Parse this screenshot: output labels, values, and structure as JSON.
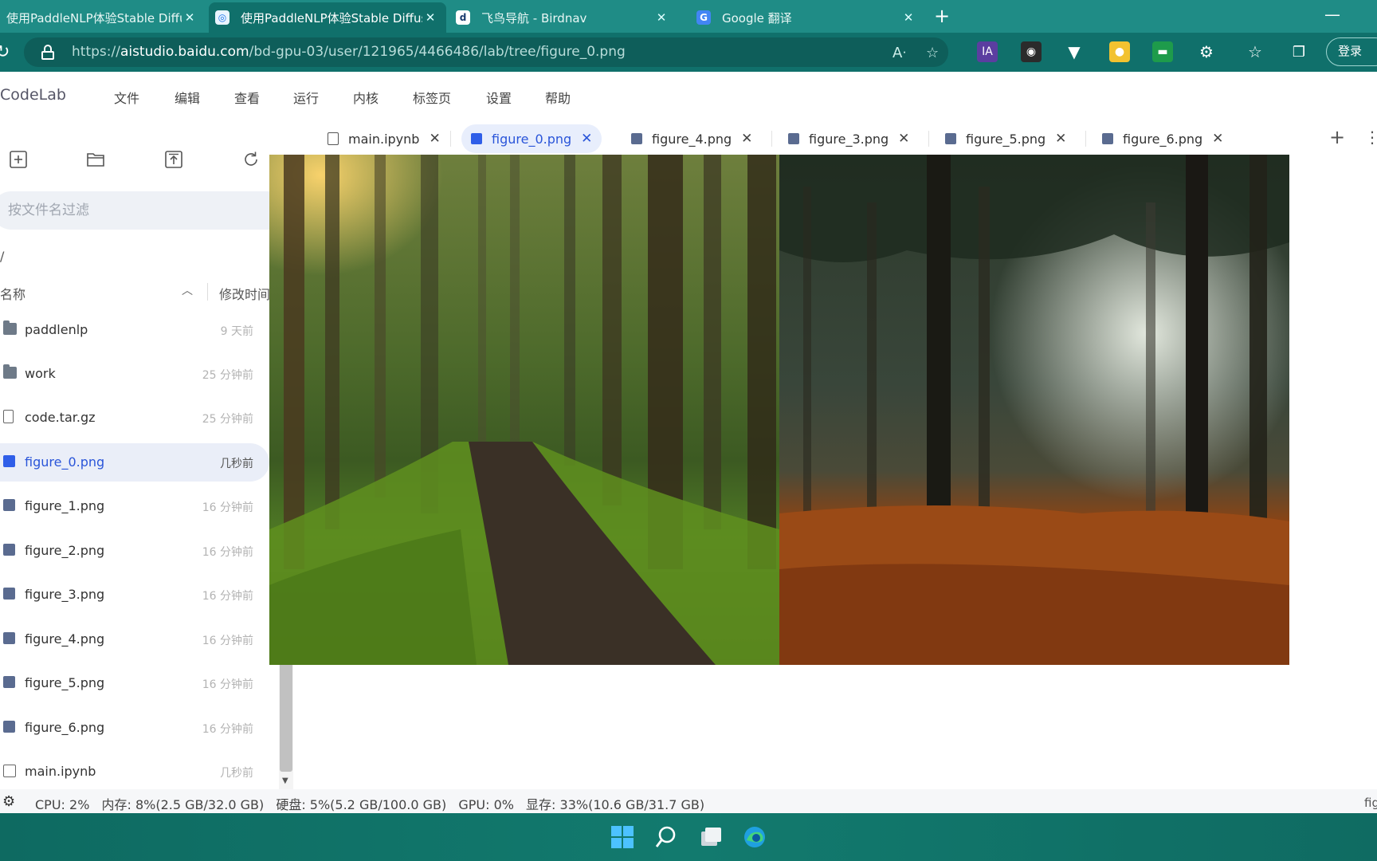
{
  "browser": {
    "tabs": [
      {
        "title": "使用PaddleNLP体验Stable Diffus",
        "active": false
      },
      {
        "title": "使用PaddleNLP体验Stable Diffus",
        "active": true
      },
      {
        "title": "飞鸟导航 - Birdnav",
        "active": false
      },
      {
        "title": "Google 翻译",
        "active": false
      }
    ],
    "url_host": "aistudio.baidu.com",
    "url_prefix": "https://",
    "url_path": "/bd-gpu-03/user/121965/4466486/lab/tree/figure_0.png",
    "extension_ia": "IA",
    "login_label": "登录"
  },
  "app": {
    "brand": "CodeLab",
    "menu": [
      "文件",
      "编辑",
      "查看",
      "运行",
      "内核",
      "标签页",
      "设置",
      "帮助"
    ]
  },
  "filebrowser": {
    "filter_placeholder": "按文件名过滤",
    "breadcrumb": "/",
    "col_name": "名称",
    "col_modified": "修改时间",
    "items": [
      {
        "name": "paddlenlp",
        "time": "9 天前",
        "kind": "folder"
      },
      {
        "name": "work",
        "time": "25 分钟前",
        "kind": "folder"
      },
      {
        "name": "code.tar.gz",
        "time": "25 分钟前",
        "kind": "file"
      },
      {
        "name": "figure_0.png",
        "time": "几秒前",
        "kind": "image",
        "selected": true
      },
      {
        "name": "figure_1.png",
        "time": "16 分钟前",
        "kind": "image"
      },
      {
        "name": "figure_2.png",
        "time": "16 分钟前",
        "kind": "image"
      },
      {
        "name": "figure_3.png",
        "time": "16 分钟前",
        "kind": "image"
      },
      {
        "name": "figure_4.png",
        "time": "16 分钟前",
        "kind": "image"
      },
      {
        "name": "figure_5.png",
        "time": "16 分钟前",
        "kind": "image"
      },
      {
        "name": "figure_6.png",
        "time": "16 分钟前",
        "kind": "image"
      },
      {
        "name": "main.ipynb",
        "time": "几秒前",
        "kind": "notebook"
      }
    ]
  },
  "doc_tabs": [
    {
      "label": "main.ipynb",
      "kind": "notebook"
    },
    {
      "label": "figure_0.png",
      "kind": "image",
      "active": true
    },
    {
      "label": "figure_4.png",
      "kind": "image"
    },
    {
      "label": "figure_3.png",
      "kind": "image"
    },
    {
      "label": "figure_5.png",
      "kind": "image"
    },
    {
      "label": "figure_6.png",
      "kind": "image"
    }
  ],
  "status": {
    "cpu": "CPU:  2%",
    "mem": "内存:  8%(2.5 GB/32.0 GB)",
    "disk": "硬盘:  5%(5.2 GB/100.0 GB)",
    "gpu": "GPU:  0%",
    "vram": "显存:  33%(10.6 GB/31.7 GB)",
    "right": "fig"
  },
  "colors": {
    "accent": "#2f5ee8",
    "tabbar": "#1f8c86",
    "taskbar": "#127a6e"
  }
}
